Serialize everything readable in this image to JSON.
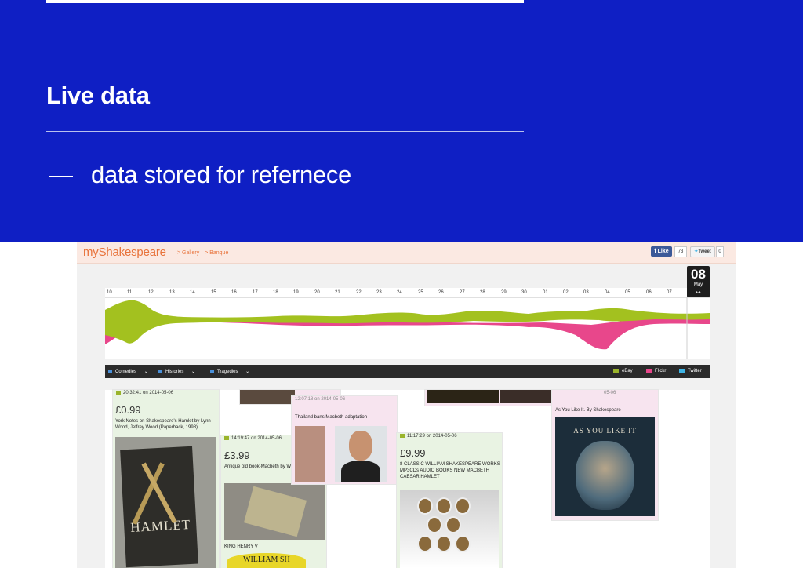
{
  "slide": {
    "title": "Live data",
    "bullet_dash": "—",
    "bullet_text": "data stored for refernece"
  },
  "site": {
    "logo": "myShakespeare",
    "breadcrumbs": [
      "> Gallery",
      "> Banque"
    ],
    "like_label": "Like",
    "like_count": "73",
    "tweet_label": "Tweet",
    "tweet_count": "0"
  },
  "timeline": {
    "ticks": [
      "10",
      "11",
      "12",
      "13",
      "14",
      "15",
      "16",
      "17",
      "18",
      "19",
      "20",
      "21",
      "22",
      "23",
      "24",
      "25",
      "26",
      "27",
      "28",
      "29",
      "30",
      "01",
      "02",
      "03",
      "04",
      "05",
      "06",
      "07"
    ],
    "selected_day": "08",
    "selected_month": "May",
    "arrow": "↔"
  },
  "filters": {
    "left": [
      "Comedies",
      "Histories",
      "Tragedies"
    ],
    "chevron": "⌄",
    "sources": [
      {
        "label": "eBay",
        "color": "#9ab42b"
      },
      {
        "label": "Flickr",
        "color": "#e8478b"
      },
      {
        "label": "Twitter",
        "color": "#3fb4e5"
      }
    ]
  },
  "colors": {
    "slide_bg": "#0f1fc4",
    "ebay": "#9ab42b",
    "flickr": "#e8478b"
  },
  "cards": [
    {
      "meta": "20:32:41 on 2014-05-06",
      "price": "£0.99",
      "desc": "York Notes on Shakespeare's Hamlet by Lynn Wood, Jeffrey Wood (Paperback, 1998)",
      "image_text": "HAMLET"
    },
    {
      "meta": "14:19:47 on 2014-05-06",
      "price": "£3.99",
      "desc": "Antique old book-Macbeth by W.Shakespeare",
      "footer": "KING HENRY V"
    },
    {
      "meta": "12:07:18 on 2014-05-06",
      "desc": "Thailand bans Macbeth adaptation"
    },
    {
      "meta": "11:17:29 on 2014-05-06",
      "price": "£9.99",
      "desc": "8 CLASSIC WILLIAM SHAKESPEARE WORKS MP3CDs AUDIO BOOKS NEW MACBETH CAESAR HAMLET"
    },
    {
      "meta": "05-06",
      "desc": "As You Like It. By Shakespeare",
      "image_text": "AS YOU LIKE IT"
    }
  ],
  "misc": {
    "partial_text": "WILLIAM SH"
  }
}
